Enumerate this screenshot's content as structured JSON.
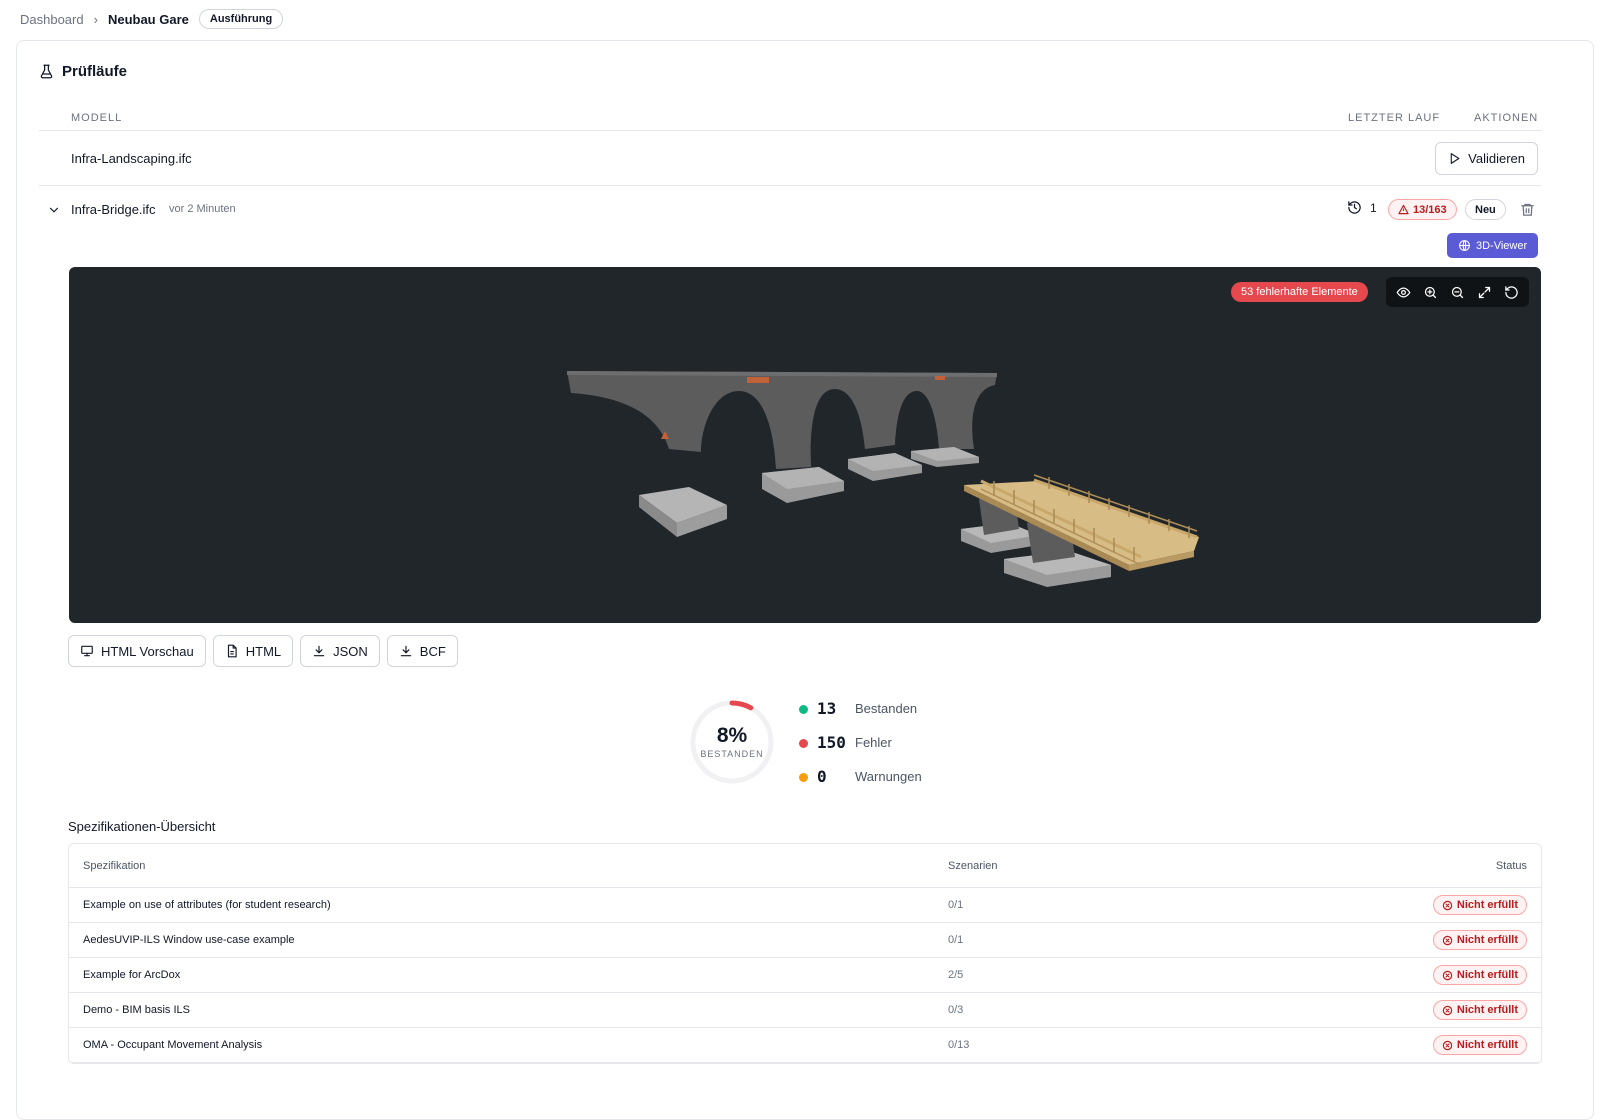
{
  "breadcrumb": {
    "root": "Dashboard",
    "separator": "›",
    "current": "Neubau Gare",
    "status": "Ausführung"
  },
  "section": {
    "title": "Prüfläufe",
    "icon": "flask-icon"
  },
  "table": {
    "col_model": "MODELL",
    "col_last_run": "LETZTER LAUF",
    "col_actions": "AKTIONEN"
  },
  "models": [
    {
      "name": "Infra-Landscaping.ifc",
      "action_label": "Validieren"
    },
    {
      "name": "Infra-Bridge.ifc",
      "time": "vor 2 Minuten",
      "run_count": "1",
      "issues": "13/163",
      "tag": "Neu"
    }
  ],
  "viewer": {
    "button_label": "3D-Viewer",
    "error_badge": "53 fehlerhafte Elemente",
    "tools": [
      "eye-icon",
      "zoom-in-icon",
      "zoom-out-icon",
      "expand-icon",
      "reset-icon"
    ]
  },
  "exports": [
    {
      "label": "HTML Vorschau",
      "icon": "monitor-icon"
    },
    {
      "label": "HTML",
      "icon": "file-icon"
    },
    {
      "label": "JSON",
      "icon": "download-icon"
    },
    {
      "label": "BCF",
      "icon": "download-icon"
    }
  ],
  "summary": {
    "percent_label": "8%",
    "percent_value": 8,
    "percent_caption": "BESTANDEN",
    "items": [
      {
        "value": "13",
        "label": "Bestanden",
        "color": "#10b981"
      },
      {
        "value": "150",
        "label": "Fehler",
        "color": "#e5484d"
      },
      {
        "value": "0",
        "label": "Warnungen",
        "color": "#f59e0b"
      }
    ]
  },
  "specs": {
    "title": "Spezifikationen-Übersicht",
    "col_spec": "Spezifikation",
    "col_scenarios": "Szenarien",
    "col_status": "Status",
    "rows": [
      {
        "name": "Example on use of attributes (for student research)",
        "scenarios": "0/1",
        "status": "Nicht erfüllt"
      },
      {
        "name": "AedesUVIP-ILS Window use-case example",
        "scenarios": "0/1",
        "status": "Nicht erfüllt"
      },
      {
        "name": "Example for ArcDox",
        "scenarios": "2/5",
        "status": "Nicht erfüllt"
      },
      {
        "name": "Demo - BIM basis ILS",
        "scenarios": "0/3",
        "status": "Nicht erfüllt"
      },
      {
        "name": "OMA - Occupant Movement Analysis",
        "scenarios": "0/13",
        "status": "Nicht erfüllt"
      }
    ]
  },
  "colors": {
    "accent": "#5b5bd6",
    "error": "#e5484d",
    "success": "#10b981",
    "warning": "#f59e0b",
    "viewer_bg": "#21262b"
  }
}
